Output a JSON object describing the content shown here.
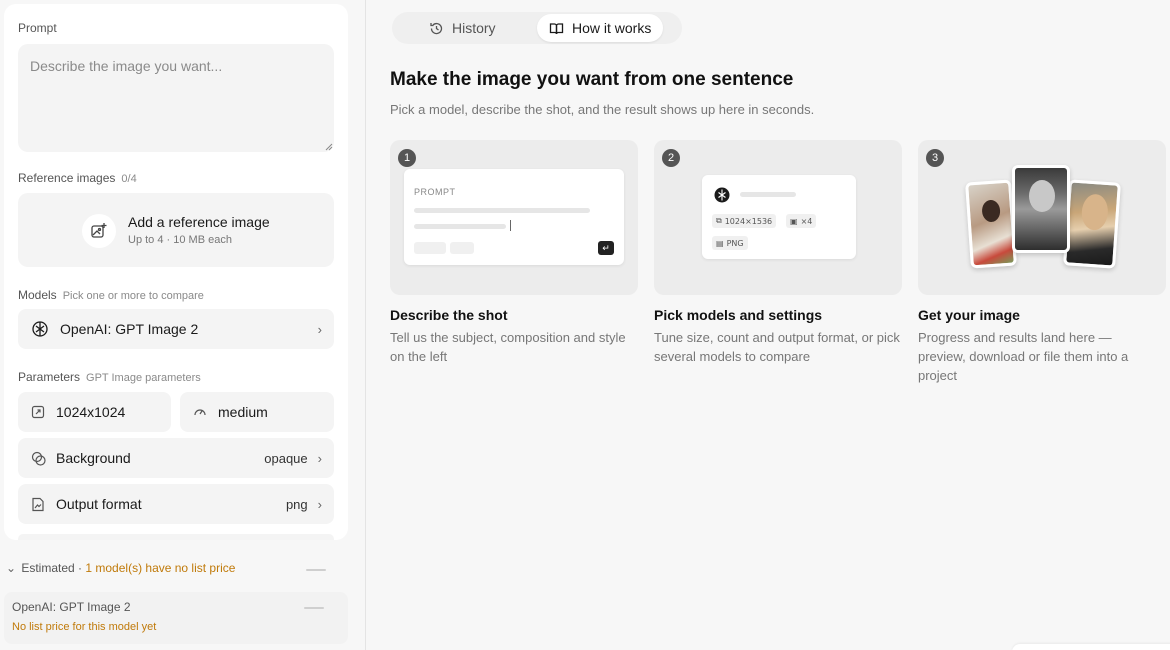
{
  "sidebar": {
    "prompt_label": "Prompt",
    "prompt_placeholder": "Describe the image you want...",
    "reference": {
      "label": "Reference images",
      "count": "0/4",
      "button_title": "Add a reference image",
      "button_sub": "Up to 4 · 10 MB each"
    },
    "models": {
      "label": "Models",
      "hint": "Pick one or more to compare",
      "selected": "OpenAI: GPT Image 2"
    },
    "parameters": {
      "label": "Parameters",
      "hint": "GPT Image parameters",
      "size": "1024x1024",
      "quality": "medium",
      "background_label": "Background",
      "background_value": "opaque",
      "format_label": "Output format",
      "format_value": "png"
    },
    "estimate": {
      "label": "Estimated",
      "separator": " · ",
      "warning": "1 model(s) have no list price"
    },
    "model_price": {
      "name": "OpenAI: GPT Image 2",
      "note": "No list price for this model yet"
    }
  },
  "tabs": [
    {
      "label": "History",
      "icon": "history-icon",
      "active": false
    },
    {
      "label": "How it works",
      "icon": "book-icon",
      "active": true
    }
  ],
  "main": {
    "title": "Make the image you want from one sentence",
    "subtitle": "Pick a model, describe the shot, and the result shows up here in seconds.",
    "steps": [
      {
        "num": "1",
        "title": "Describe the shot",
        "desc": "Tell us the subject, composition and style on the left",
        "illustration_label": "PROMPT"
      },
      {
        "num": "2",
        "title": "Pick models and settings",
        "desc": "Tune size, count and output format, or pick several models to compare",
        "chips": [
          "1024×1536",
          "×4",
          "PNG"
        ]
      },
      {
        "num": "3",
        "title": "Get your image",
        "desc": "Progress and results land here — preview, download or file them into a project"
      }
    ]
  },
  "colors": {
    "warning": "#c07a0a",
    "accent_dark": "#1a1a1a"
  }
}
